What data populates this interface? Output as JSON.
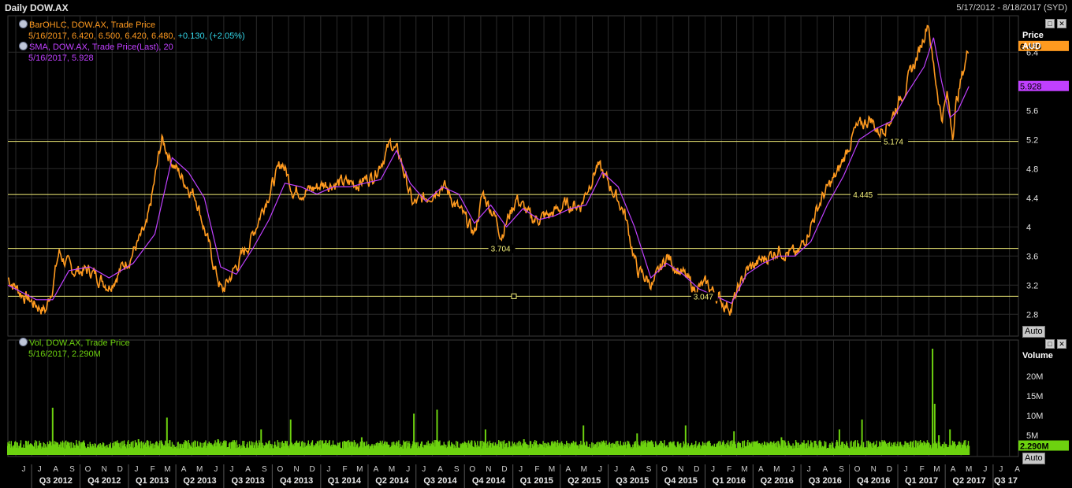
{
  "header": {
    "title": "Daily DOW.AX",
    "date_range": "5/17/2012 - 8/18/2017 (SYD)"
  },
  "legend": {
    "ohlc_line1": "BarOHLC, DOW.AX, Trade Price",
    "ohlc_values": "5/16/2017, 6.420, 6.500, 6.420, 6.480,",
    "ohlc_change": "+0.130, (+2.05%)",
    "sma_line1": "SMA, DOW.AX, Trade Price(Last),  20",
    "sma_values": "5/16/2017, 5.928",
    "vol_line1": "Vol, DOW.AX, Trade Price",
    "vol_values": "5/16/2017, 2.290M"
  },
  "price_axis": {
    "head1": "Price",
    "head2": "AUD",
    "last_tag": "6.480",
    "sma_tag": "5.928",
    "auto_label": "Auto"
  },
  "volume_axis": {
    "head": "Volume",
    "last_tag": "2.290M",
    "auto_label": "Auto"
  },
  "buttons": {
    "maximize": "□",
    "close": "✕"
  },
  "colors": {
    "background": "#000000",
    "price": "#ff9a1f",
    "sma": "#c040ff",
    "volume": "#6dd20f",
    "hline": "#f5f07a",
    "grid": "#2a2a2a"
  },
  "chart_data": [
    {
      "type": "line",
      "title": "Daily DOW.AX",
      "ylabel": "Price AUD",
      "ylim": [
        2.5,
        6.9
      ],
      "yticks": [
        2.8,
        3.2,
        3.6,
        4,
        4.4,
        4.8,
        5.2,
        5.6,
        6.4
      ],
      "x_range": [
        "2012-05-17",
        "2017-08-18"
      ],
      "month_labels": [
        "J",
        "J",
        "A",
        "S",
        "O",
        "N",
        "D",
        "J",
        "F",
        "M",
        "A",
        "M",
        "J",
        "J",
        "A",
        "S",
        "O",
        "N",
        "D",
        "J",
        "F",
        "M",
        "A",
        "M",
        "J",
        "J",
        "A",
        "S",
        "O",
        "N",
        "D",
        "J",
        "F",
        "M",
        "A",
        "M",
        "J",
        "J",
        "A",
        "S",
        "O",
        "N",
        "D",
        "J",
        "F",
        "M",
        "A",
        "M",
        "J",
        "J",
        "A",
        "S",
        "O",
        "N",
        "D",
        "J",
        "F",
        "M",
        "A",
        "M",
        "J",
        "J",
        "A"
      ],
      "quarter_labels": [
        "Q3 2012",
        "Q4 2012",
        "Q1 2013",
        "Q2 2013",
        "Q3 2013",
        "Q4 2013",
        "Q1 2014",
        "Q2 2014",
        "Q3 2014",
        "Q4 2014",
        "Q1 2015",
        "Q2 2015",
        "Q3 2015",
        "Q4 2015",
        "Q1 2016",
        "Q2 2016",
        "Q3 2016",
        "Q4 2016",
        "Q1 2017",
        "Q2 2017",
        "Q3 17"
      ],
      "series": [
        {
          "name": "BarOHLC, DOW.AX, Trade Price",
          "x": [
            "2012-05-17",
            "2012-06-10",
            "2012-07-05",
            "2012-07-28",
            "2012-08-10",
            "2012-08-22",
            "2012-09-15",
            "2012-10-20",
            "2012-11-25",
            "2013-01-05",
            "2013-02-05",
            "2013-03-05",
            "2013-03-25",
            "2013-04-10",
            "2013-05-10",
            "2013-06-15",
            "2013-06-28",
            "2013-07-20",
            "2013-08-20",
            "2013-09-15",
            "2013-10-20",
            "2013-11-10",
            "2013-12-10",
            "2014-01-10",
            "2014-02-10",
            "2014-03-10",
            "2014-04-10",
            "2014-05-15",
            "2014-06-01",
            "2014-06-25",
            "2014-07-20",
            "2014-08-20",
            "2014-09-15",
            "2014-10-20",
            "2014-11-05",
            "2014-11-25",
            "2014-12-10",
            "2015-01-08",
            "2015-02-05",
            "2015-03-10",
            "2015-04-10",
            "2015-05-10",
            "2015-06-10",
            "2015-07-10",
            "2015-08-01",
            "2015-08-25",
            "2015-09-25",
            "2015-10-20",
            "2015-11-20",
            "2015-12-10",
            "2016-01-05",
            "2016-02-05",
            "2016-02-20",
            "2016-03-20",
            "2016-04-20",
            "2016-05-20",
            "2016-06-25",
            "2016-07-15",
            "2016-08-10",
            "2016-09-10",
            "2016-10-10",
            "2016-11-10",
            "2016-11-25",
            "2016-12-20",
            "2017-01-20",
            "2017-02-10",
            "2017-02-28",
            "2017-03-08",
            "2017-03-25",
            "2017-04-05",
            "2017-04-15",
            "2017-04-22",
            "2017-05-01",
            "2017-05-16"
          ],
          "values": [
            3.3,
            3.1,
            2.95,
            2.85,
            3.2,
            3.65,
            3.4,
            3.4,
            3.2,
            3.6,
            4.0,
            5.2,
            4.9,
            4.7,
            4.4,
            3.4,
            3.1,
            3.4,
            3.8,
            4.3,
            4.9,
            4.5,
            4.5,
            4.6,
            4.6,
            4.6,
            4.7,
            5.15,
            4.95,
            4.3,
            4.4,
            4.6,
            4.3,
            3.9,
            4.45,
            4.2,
            3.9,
            4.4,
            4.1,
            4.15,
            4.3,
            4.3,
            4.85,
            4.5,
            4.2,
            3.4,
            3.2,
            3.6,
            3.35,
            3.15,
            3.2,
            2.95,
            2.9,
            3.4,
            3.55,
            3.7,
            3.6,
            3.95,
            4.4,
            4.75,
            5.3,
            5.5,
            5.3,
            5.5,
            6.0,
            6.4,
            6.85,
            6.3,
            5.5,
            5.8,
            5.3,
            5.7,
            6.0,
            6.48
          ]
        },
        {
          "name": "SMA, DOW.AX, Trade Price(Last), 20",
          "x": [
            "2012-05-17",
            "2012-07-10",
            "2012-08-10",
            "2012-09-10",
            "2012-10-20",
            "2012-11-25",
            "2013-01-10",
            "2013-02-20",
            "2013-03-25",
            "2013-04-25",
            "2013-05-25",
            "2013-06-25",
            "2013-07-25",
            "2013-08-25",
            "2013-09-25",
            "2013-10-25",
            "2013-11-25",
            "2013-12-25",
            "2014-01-25",
            "2014-02-25",
            "2014-03-25",
            "2014-04-25",
            "2014-05-25",
            "2014-06-20",
            "2014-07-20",
            "2014-08-20",
            "2014-09-20",
            "2014-10-20",
            "2014-11-20",
            "2014-12-20",
            "2015-01-20",
            "2015-02-20",
            "2015-03-20",
            "2015-04-20",
            "2015-05-20",
            "2015-06-20",
            "2015-07-20",
            "2015-08-20",
            "2015-09-20",
            "2015-10-20",
            "2015-11-20",
            "2015-12-20",
            "2016-01-20",
            "2016-02-20",
            "2016-03-20",
            "2016-04-20",
            "2016-05-20",
            "2016-06-20",
            "2016-07-20",
            "2016-08-20",
            "2016-09-20",
            "2016-10-20",
            "2016-11-20",
            "2016-12-20",
            "2017-01-20",
            "2017-02-20",
            "2017-03-10",
            "2017-03-25",
            "2017-04-10",
            "2017-04-25",
            "2017-05-16"
          ],
          "values": [
            3.2,
            3.0,
            3.0,
            3.4,
            3.45,
            3.3,
            3.5,
            3.9,
            4.95,
            4.75,
            4.4,
            3.45,
            3.35,
            3.7,
            4.1,
            4.6,
            4.55,
            4.45,
            4.55,
            4.55,
            4.6,
            4.65,
            5.05,
            4.6,
            4.35,
            4.55,
            4.45,
            4.05,
            4.3,
            4.0,
            4.25,
            4.1,
            4.15,
            4.25,
            4.3,
            4.75,
            4.55,
            4.0,
            3.3,
            3.5,
            3.35,
            3.15,
            3.05,
            2.95,
            3.35,
            3.5,
            3.6,
            3.6,
            3.8,
            4.3,
            4.7,
            5.2,
            5.35,
            5.45,
            5.85,
            6.2,
            6.6,
            6.0,
            5.5,
            5.6,
            5.93
          ]
        }
      ],
      "reference_lines": [
        {
          "value": 5.174,
          "label": "5.174"
        },
        {
          "value": 4.445,
          "label": "4.445"
        },
        {
          "value": 3.704,
          "label": "3.704"
        },
        {
          "value": 3.047,
          "label": "3.047"
        }
      ]
    },
    {
      "type": "bar",
      "title": "Vol, DOW.AX, Trade Price",
      "ylabel": "Volume",
      "ylim": [
        0,
        28
      ],
      "yticks": [
        "5M",
        "10M",
        "15M",
        "20M"
      ],
      "tick_values": [
        5,
        10,
        15,
        20
      ],
      "series": [
        {
          "name": "Vol, DOW.AX, Trade Price",
          "units": "M",
          "x": [
            "2012-05-17",
            "2012-08-10",
            "2012-12-10",
            "2013-01-20",
            "2013-03-15",
            "2013-06-20",
            "2013-09-10",
            "2013-11-05",
            "2014-03-20",
            "2014-06-27",
            "2014-08-10",
            "2014-11-10",
            "2015-01-22",
            "2015-05-15",
            "2015-08-25",
            "2015-11-25",
            "2016-02-25",
            "2016-05-25",
            "2016-09-12",
            "2016-10-25",
            "2017-01-15",
            "2017-03-08",
            "2017-03-12",
            "2017-03-20",
            "2017-04-10",
            "2017-05-16"
          ],
          "values": [
            2.3,
            12.0,
            3.0,
            4.0,
            9.5,
            4.0,
            6.5,
            9.0,
            4.5,
            10.5,
            11.5,
            6.5,
            4.0,
            7.5,
            5.5,
            7.5,
            6.0,
            4.5,
            6.5,
            9.0,
            3.5,
            27.0,
            13.0,
            5.0,
            6.5,
            2.29
          ]
        }
      ]
    }
  ]
}
